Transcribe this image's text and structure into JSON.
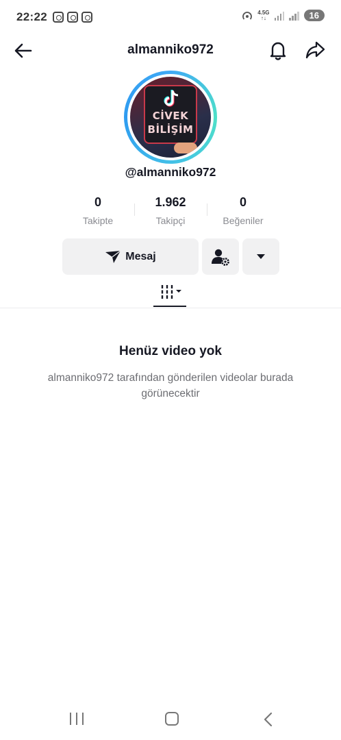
{
  "status_bar": {
    "time": "22:22",
    "network": "4.5G",
    "battery": "16"
  },
  "header": {
    "title": "almanniko972"
  },
  "avatar": {
    "logo_line1": "CİVEK",
    "logo_line2": "BİLİŞİM"
  },
  "profile": {
    "handle": "@almanniko972"
  },
  "stats": [
    {
      "value": "0",
      "label": "Takipte"
    },
    {
      "value": "1.962",
      "label": "Takipçi"
    },
    {
      "value": "0",
      "label": "Beğeniler"
    }
  ],
  "actions": {
    "message_label": "Mesaj"
  },
  "empty_state": {
    "title": "Henüz video yok",
    "description": "almanniko972 tarafından gönderilen videolar burada görünecektir"
  }
}
